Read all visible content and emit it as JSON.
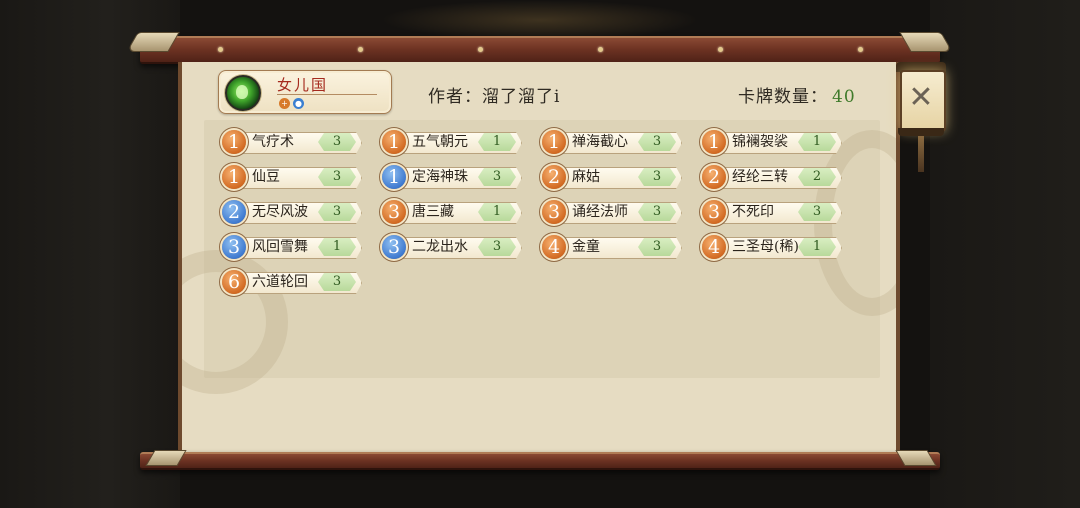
{
  "deck": {
    "faction_name": "女儿国",
    "elements": [
      "fire",
      "water"
    ],
    "author_label": "作者：溜了溜了i",
    "count_label": "卡牌数量：",
    "count_value": "40"
  },
  "icons": {
    "close": "close-icon",
    "faction_emblem": "faction-emblem-icon"
  },
  "cards": [
    {
      "cost": "1",
      "cost_color": "orange",
      "name": "气疗术",
      "qty": "3"
    },
    {
      "cost": "1",
      "cost_color": "orange",
      "name": "五气朝元",
      "qty": "1"
    },
    {
      "cost": "1",
      "cost_color": "orange",
      "name": "禅海截心",
      "qty": "3"
    },
    {
      "cost": "1",
      "cost_color": "orange",
      "name": "锦襕袈裟",
      "qty": "1"
    },
    {
      "cost": "1",
      "cost_color": "orange",
      "name": "仙豆",
      "qty": "3"
    },
    {
      "cost": "1",
      "cost_color": "blue",
      "name": "定海神珠",
      "qty": "3"
    },
    {
      "cost": "2",
      "cost_color": "orange",
      "name": "麻姑",
      "qty": "3"
    },
    {
      "cost": "2",
      "cost_color": "orange",
      "name": "经纶三转",
      "qty": "2"
    },
    {
      "cost": "2",
      "cost_color": "blue",
      "name": "无尽风波",
      "qty": "3"
    },
    {
      "cost": "3",
      "cost_color": "orange",
      "name": "唐三藏",
      "qty": "1"
    },
    {
      "cost": "3",
      "cost_color": "orange",
      "name": "诵经法师",
      "qty": "3"
    },
    {
      "cost": "3",
      "cost_color": "orange",
      "name": "不死印",
      "qty": "3"
    },
    {
      "cost": "3",
      "cost_color": "blue",
      "name": "风回雪舞",
      "qty": "1"
    },
    {
      "cost": "3",
      "cost_color": "blue",
      "name": "二龙出水",
      "qty": "3"
    },
    {
      "cost": "4",
      "cost_color": "orange",
      "name": "金童",
      "qty": "3"
    },
    {
      "cost": "4",
      "cost_color": "orange",
      "name": "三圣母(稀)",
      "qty": "1"
    },
    {
      "cost": "6",
      "cost_color": "orange",
      "name": "六道轮回",
      "qty": "3"
    }
  ]
}
